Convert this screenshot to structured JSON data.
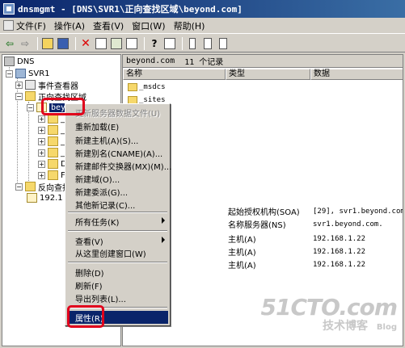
{
  "window": {
    "title": "dnsmgmt - [DNS\\SVR1\\正向查找区域\\beyond.com]"
  },
  "menubar": {
    "items": [
      {
        "label": "文件(F)",
        "icon": "file-menu-icon"
      },
      {
        "label": "操作(A)"
      },
      {
        "label": "查看(V)"
      },
      {
        "label": "窗口(W)"
      },
      {
        "label": "帮助(H)"
      }
    ]
  },
  "toolbar": {
    "buttons": [
      "back-arrow-icon",
      "forward-arrow-icon",
      "up-folder-icon",
      "console-tree-icon",
      "delete-x-icon",
      "properties-icon",
      "refresh-icon",
      "export-icon",
      "help-icon",
      "server-icon",
      "list-icon",
      "view-icon"
    ]
  },
  "tree": {
    "root": "DNS",
    "server": "SVR1",
    "event_viewer": "事件查看器",
    "forward_zones": "正向查找区域",
    "selected_zone": "beyond",
    "reverse_zones": "反向查找区域",
    "reverse_child": "192.1",
    "children_partial": [
      "_m",
      "_s",
      "_t",
      "_u",
      "Do",
      "Fo"
    ]
  },
  "list": {
    "zone_name": "beyond.com",
    "record_count": "11 个记录",
    "columns": [
      "名称",
      "类型",
      "数据"
    ],
    "rows": [
      {
        "name": "_msdcs",
        "type": "",
        "data": "",
        "folder": true
      },
      {
        "name": "_sites",
        "type": "",
        "data": "",
        "folder": true
      },
      {
        "name": "mes",
        "type": "",
        "data": "",
        "folder": false
      },
      {
        "name": "mes",
        "type": "",
        "data": "",
        "folder": false
      },
      {
        "name": "相同)",
        "type": "起始授权机构(SOA)",
        "data": "[29], svr1.beyond.com.",
        "folder": false
      },
      {
        "name": "相同)",
        "type": "名称服务器(NS)",
        "data": "svr1.beyond.com.",
        "folder": false
      },
      {
        "name": "相同)",
        "type": "主机(A)",
        "data": "192.168.1.22",
        "folder": false
      },
      {
        "name": "",
        "type": "主机(A)",
        "data": "192.168.1.22",
        "folder": false
      },
      {
        "name": "",
        "type": "主机(A)",
        "data": "192.168.1.22",
        "folder": false
      }
    ]
  },
  "context_menu": {
    "items": [
      {
        "label": "更新服务器数据文件(U)",
        "disabled": true
      },
      {
        "label": "重新加载(E)"
      },
      {
        "label": "新建主机(A)(S)..."
      },
      {
        "label": "新建别名(CNAME)(A)..."
      },
      {
        "label": "新建邮件交换器(MX)(M)..."
      },
      {
        "label": "新建域(O)..."
      },
      {
        "label": "新建委派(G)..."
      },
      {
        "label": "其他新记录(C)..."
      },
      {
        "label": "所有任务(K)",
        "submenu": true
      },
      {
        "label": "查看(V)",
        "submenu": true
      },
      {
        "label": "从这里创建窗口(W)"
      },
      {
        "label": "删除(D)"
      },
      {
        "label": "刷新(F)"
      },
      {
        "label": "导出列表(L)..."
      },
      {
        "label": "属性(R)",
        "highlighted": true
      }
    ]
  },
  "watermark": {
    "main": "51CTO.com",
    "sub": "技术博客",
    "blog": "Blog"
  },
  "colors": {
    "title_bar": "#0a246a",
    "selection": "#0a246a",
    "annotation": "#e0001b",
    "chrome": "#d4d0c8"
  }
}
